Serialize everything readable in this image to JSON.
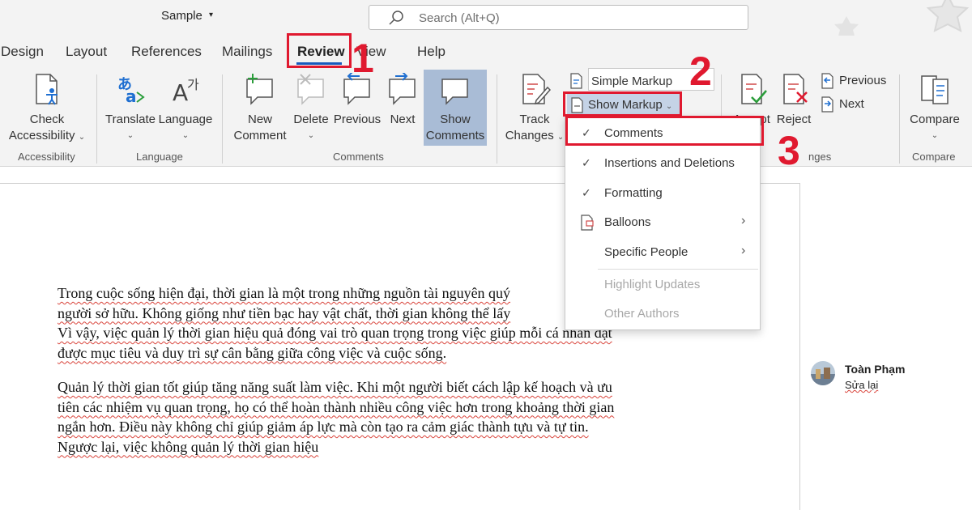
{
  "titlebar": {
    "doc_title": "Sample",
    "doc_title_caret": "▾",
    "search_placeholder": "Search (Alt+Q)"
  },
  "tabs": [
    {
      "label": "Design"
    },
    {
      "label": "Layout"
    },
    {
      "label": "References"
    },
    {
      "label": "Mailings"
    },
    {
      "label": "Review",
      "active": true
    },
    {
      "label": "View"
    },
    {
      "label": "Help"
    }
  ],
  "ribbon": {
    "accessibility": {
      "check_line1": "Check",
      "check_line2": "Accessibility",
      "group_label": "Accessibility"
    },
    "language": {
      "translate": "Translate",
      "language": "Language",
      "group_label": "Language"
    },
    "comments": {
      "new_line1": "New",
      "new_line2": "Comment",
      "delete": "Delete",
      "previous": "Previous",
      "next": "Next",
      "show_line1": "Show",
      "show_line2": "Comments",
      "group_label": "Comments"
    },
    "tracking": {
      "track_line1": "Track",
      "track_line2": "Changes",
      "markup_mode": "Simple Markup",
      "show_markup": "Show Markup"
    },
    "changes": {
      "accept": "Accept",
      "reject": "Reject",
      "previous": "Previous",
      "next": "Next",
      "group_label": "Changes",
      "group_label_visible": "nges"
    },
    "compare": {
      "compare": "Compare",
      "group_label": "Compare"
    }
  },
  "markup_menu": {
    "items": [
      {
        "label": "Comments",
        "checked": "✓"
      },
      {
        "label": "Insertions and Deletions",
        "checked": "✓"
      },
      {
        "label": "Formatting",
        "checked": "✓"
      },
      {
        "label": "Balloons",
        "submenu": "›"
      },
      {
        "label": "Specific People",
        "submenu": "›"
      },
      {
        "label": "Highlight Updates",
        "disabled": true
      },
      {
        "label": "Other Authors",
        "disabled": true
      }
    ]
  },
  "annotations": {
    "step1": "1",
    "step2": "2",
    "step3": "3",
    "color": "#e0192f"
  },
  "document": {
    "paragraph1": [
      "Trong cuộc sống hiện đại, thời gian là một trong những nguồn tài nguyên quý",
      "người sở hữu. Không giống như tiền bạc hay vật chất, thời gian không thể lấy",
      "Vì vậy, việc quản lý thời gian hiệu quả đóng vai trò quan trọng trong việc giúp mỗi cá nhân đạt",
      "được mục tiêu và duy trì sự cân bằng giữa công việc và cuộc sống."
    ],
    "paragraph2": [
      "Quản lý thời gian tốt giúp tăng năng suất làm việc. Khi một người biết cách lập kế hoạch và ưu",
      "tiên các nhiệm vụ quan trọng, họ có thể hoàn thành nhiều công việc hơn trong khoảng thời gian",
      "ngắn hơn. Điều này không chỉ giúp giảm áp lực mà còn tạo ra cảm giác thành tựu và tự tin.",
      "Ngược lại, việc không quản lý thời gian hiệu"
    ]
  },
  "comment": {
    "author": "Toàn Phạm",
    "text": "Sửa lại"
  },
  "colors": {
    "accent": "#185abd",
    "show_comments_bg": "#a9bcd6",
    "ribbon_bg": "#f3f3f3"
  }
}
